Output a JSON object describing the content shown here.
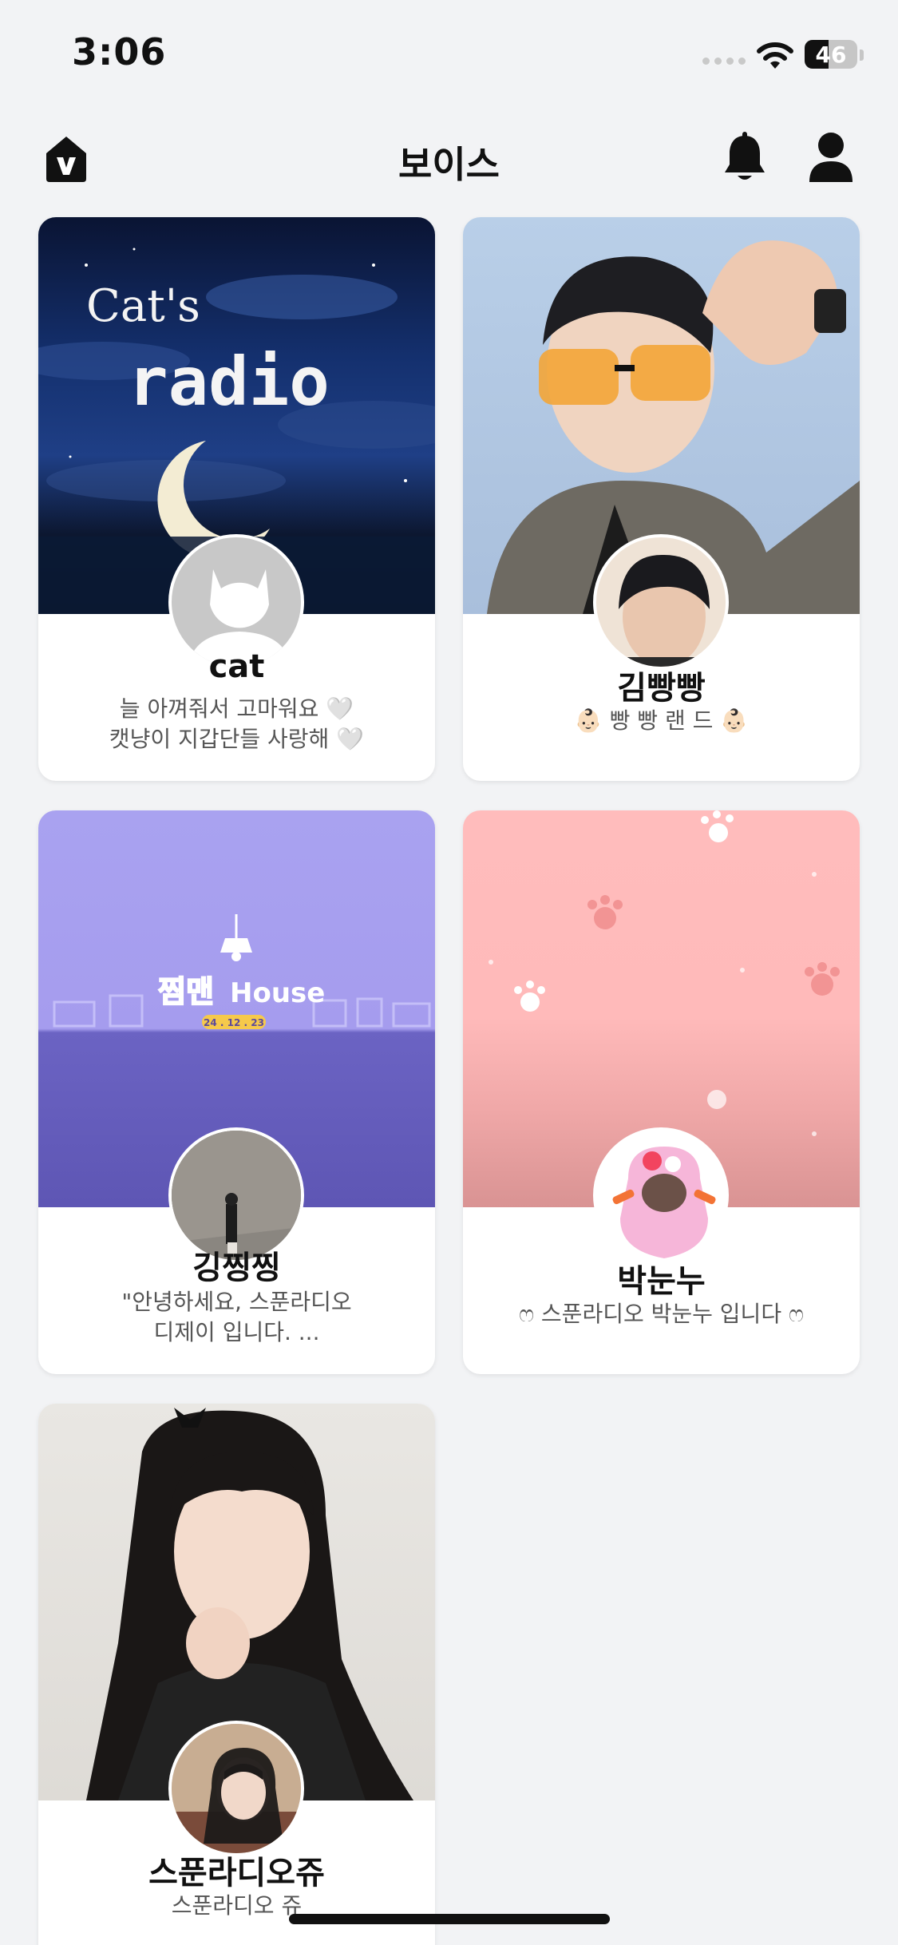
{
  "status_bar": {
    "time": "3:06",
    "battery": "46"
  },
  "header": {
    "title": "보이스"
  },
  "cards": [
    {
      "name": "cat",
      "bio": "늘 아껴줘서 고마워요 🤍\n캣냥이 지갑단들 사랑해 🤍",
      "cover_text": [
        "Cat's",
        "radio"
      ]
    },
    {
      "name": "김빵빵",
      "bio": "👶🏻 빵 빵 랜 드 👶🏻"
    },
    {
      "name": "깅찡찡",
      "bio": "\"안녕하세요, 스푼라디오\n디제이 입니다. ...",
      "cover_text": [
        "찜맨",
        "House",
        "24 . 12 . 23"
      ]
    },
    {
      "name": "박눈누",
      "bio": "ෆ 스푼라디오 박눈누 입니다 ෆ"
    },
    {
      "name": "스푼라디오쥬",
      "bio": "스푼라디오 쥬"
    }
  ]
}
